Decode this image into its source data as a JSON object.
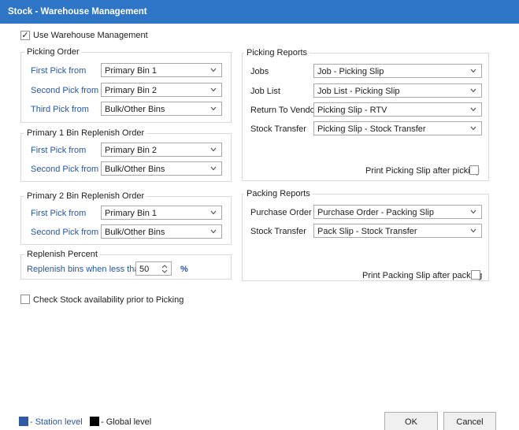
{
  "window": {
    "title": "Stock - Warehouse Management"
  },
  "use_warehouse": {
    "label": "Use Warehouse Management",
    "checked": true
  },
  "picking_order": {
    "title": "Picking Order",
    "rows": [
      {
        "label": "First Pick from",
        "value": "Primary Bin 1"
      },
      {
        "label": "Second Pick from",
        "value": "Primary Bin 2"
      },
      {
        "label": "Third Pick from",
        "value": "Bulk/Other Bins"
      }
    ]
  },
  "primary1": {
    "title": "Primary 1 Bin Replenish Order",
    "rows": [
      {
        "label": "First Pick from",
        "value": "Primary Bin 2"
      },
      {
        "label": "Second Pick from",
        "value": "Bulk/Other Bins"
      }
    ]
  },
  "primary2": {
    "title": "Primary 2 Bin Replenish Order",
    "rows": [
      {
        "label": "First Pick from",
        "value": "Primary Bin 1"
      },
      {
        "label": "Second Pick from",
        "value": "Bulk/Other Bins"
      }
    ]
  },
  "replenish": {
    "title": "Replenish Percent",
    "label": "Replenish bins when less than",
    "value": "50",
    "unit": "%"
  },
  "check_stock": {
    "label": "Check Stock availability prior to Picking",
    "checked": false
  },
  "picking_reports": {
    "title": "Picking Reports",
    "rows": [
      {
        "label": "Jobs",
        "value": "Job - Picking Slip"
      },
      {
        "label": "Job List",
        "value": "Job List - Picking Slip"
      },
      {
        "label": "Return To Vendor",
        "value": "Picking Slip - RTV"
      },
      {
        "label": "Stock Transfer",
        "value": "Picking Slip - Stock Transfer"
      }
    ],
    "print_label": "Print Picking Slip after picking",
    "print_checked": false
  },
  "packing_reports": {
    "title": "Packing Reports",
    "rows": [
      {
        "label": "Purchase Order",
        "value": "Purchase Order - Packing Slip"
      },
      {
        "label": "Stock Transfer",
        "value": "Pack Slip - Stock Transfer"
      }
    ],
    "print_label": "Print Packing Slip after packing",
    "print_checked": false
  },
  "legend": {
    "station_label": "- Station level",
    "station_color": "#2e5aa8",
    "global_label": "- Global level",
    "global_color": "#000000"
  },
  "buttons": {
    "ok": "OK",
    "cancel": "Cancel"
  },
  "colors": {
    "titlebar": "#2e75c6",
    "field_label_blue": "#2457a8"
  }
}
